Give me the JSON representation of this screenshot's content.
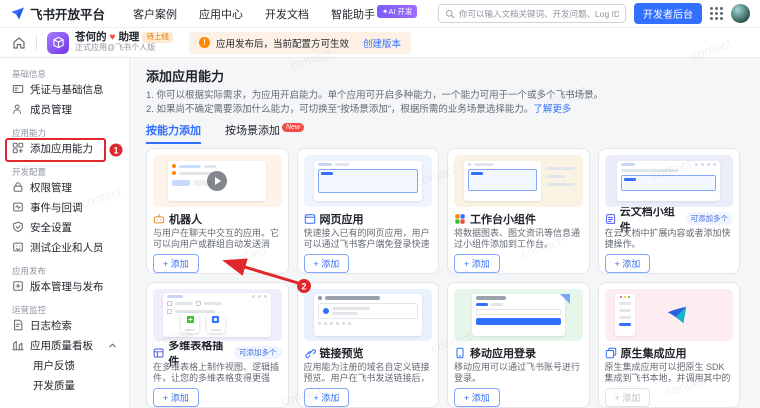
{
  "topnav": {
    "brand": "飞书开放平台",
    "menu": [
      "客户案例",
      "应用中心",
      "开发文档",
      "智能助手"
    ],
    "ai_badge": "AI 开发",
    "search_placeholder": "你可以输入文档关键词、开发问题、Log ID、错误码",
    "dev_console_button": "开发者后台"
  },
  "appbar": {
    "app_name_prefix": "苍何的",
    "app_name_icon": "heart-icon",
    "app_name_suffix": "助理",
    "status_badge": "待上线",
    "subtitle": "正式应用@飞书个人版",
    "notice_text": "应用发布后，当前配置方可生效",
    "notice_link": "创建版本"
  },
  "sidebar": {
    "sections": [
      {
        "label": "基础信息",
        "items": [
          {
            "label": "凭证与基础信息",
            "icon": "id-card-icon"
          },
          {
            "label": "成员管理",
            "icon": "member-icon"
          }
        ]
      },
      {
        "label": "应用能力",
        "items": [
          {
            "label": "添加应用能力",
            "icon": "add-capability-icon"
          }
        ]
      },
      {
        "label": "开发配置",
        "items": [
          {
            "label": "权限管理",
            "icon": "lock-icon"
          },
          {
            "label": "事件与回调",
            "icon": "event-callback-icon"
          },
          {
            "label": "安全设置",
            "icon": "shield-icon"
          },
          {
            "label": "测试企业和人员",
            "icon": "test-org-icon"
          }
        ]
      },
      {
        "label": "应用发布",
        "items": [
          {
            "label": "版本管理与发布",
            "icon": "version-release-icon"
          }
        ]
      },
      {
        "label": "运营监控",
        "items": [
          {
            "label": "日志检索",
            "icon": "log-search-icon"
          },
          {
            "label": "应用质量看板",
            "icon": "quality-dashboard-icon",
            "expanded": true,
            "children": [
              {
                "label": "用户反馈"
              },
              {
                "label": "开发质量"
              }
            ]
          }
        ]
      }
    ]
  },
  "main": {
    "title": "添加应用能力",
    "desc_line1": "1. 你可以根据实际需求，为应用开启能力。单个应用可开启多种能力，一个能力可用于一个或多个飞书场景。",
    "desc_line2": "2. 如果尚不确定需要添加什么能力，可切换至“按场景添加”，根据所需的业务场景选择能力。",
    "learn_more": "了解更多",
    "tabs": [
      {
        "label": "按能力添加",
        "active": true
      },
      {
        "label": "按场景添加",
        "badge": "New"
      }
    ],
    "add_label": "+ 添加",
    "cards": [
      {
        "name": "机器人",
        "icon": "robot-icon",
        "badge": "",
        "desc": "与用户在聊天中交互的应用。它可以向用户或群组自动发送消息，响应用户的消..."
      },
      {
        "name": "网页应用",
        "icon": "web-app-icon",
        "badge": "",
        "desc": "快速接入已有的网页应用，用户可以通过飞书客户端免登录快速进入。"
      },
      {
        "name": "工作台小组件",
        "icon": "workplace-widget-icon",
        "badge": "",
        "desc": "将数据图表、图文资讯等信息通过小组件添加到工作台。"
      },
      {
        "name": "云文档小组件",
        "icon": "docs-widget-icon",
        "badge": "可添加多个",
        "desc": "在云文档中扩展内容或者添加快捷操作。"
      },
      {
        "name": "多维表格插件",
        "icon": "base-plugin-icon",
        "badge": "可添加多个",
        "desc": "在多维表格上制作视图、逻辑插件，让您的多维表格变得更强大。"
      },
      {
        "name": "链接预览",
        "icon": "link-preview-icon",
        "badge": "",
        "desc": "应用能为注册的域名自定义链接预览。用户在飞书发送链接后，能在链接下方展示..."
      },
      {
        "name": "移动应用登录",
        "icon": "mobile-login-icon",
        "badge": "",
        "desc": "移动应用可以通过飞书账号进行登录。"
      },
      {
        "name": "原生集成应用",
        "icon": "native-app-icon",
        "badge": "",
        "desc": "原生集成应用可以把原生 SDK 集成到飞书本地，并调用其中的对应方法，为用户提...",
        "disabled": true
      }
    ]
  },
  "annotations": {
    "step_1": "1",
    "step_2": "2"
  },
  "watermark": {
    "text": "contact"
  },
  "colors": {
    "accent": "#3370ff",
    "warning": "#ff8800",
    "annotation_red": "#e0272b",
    "new_badge": "#f54a45"
  }
}
